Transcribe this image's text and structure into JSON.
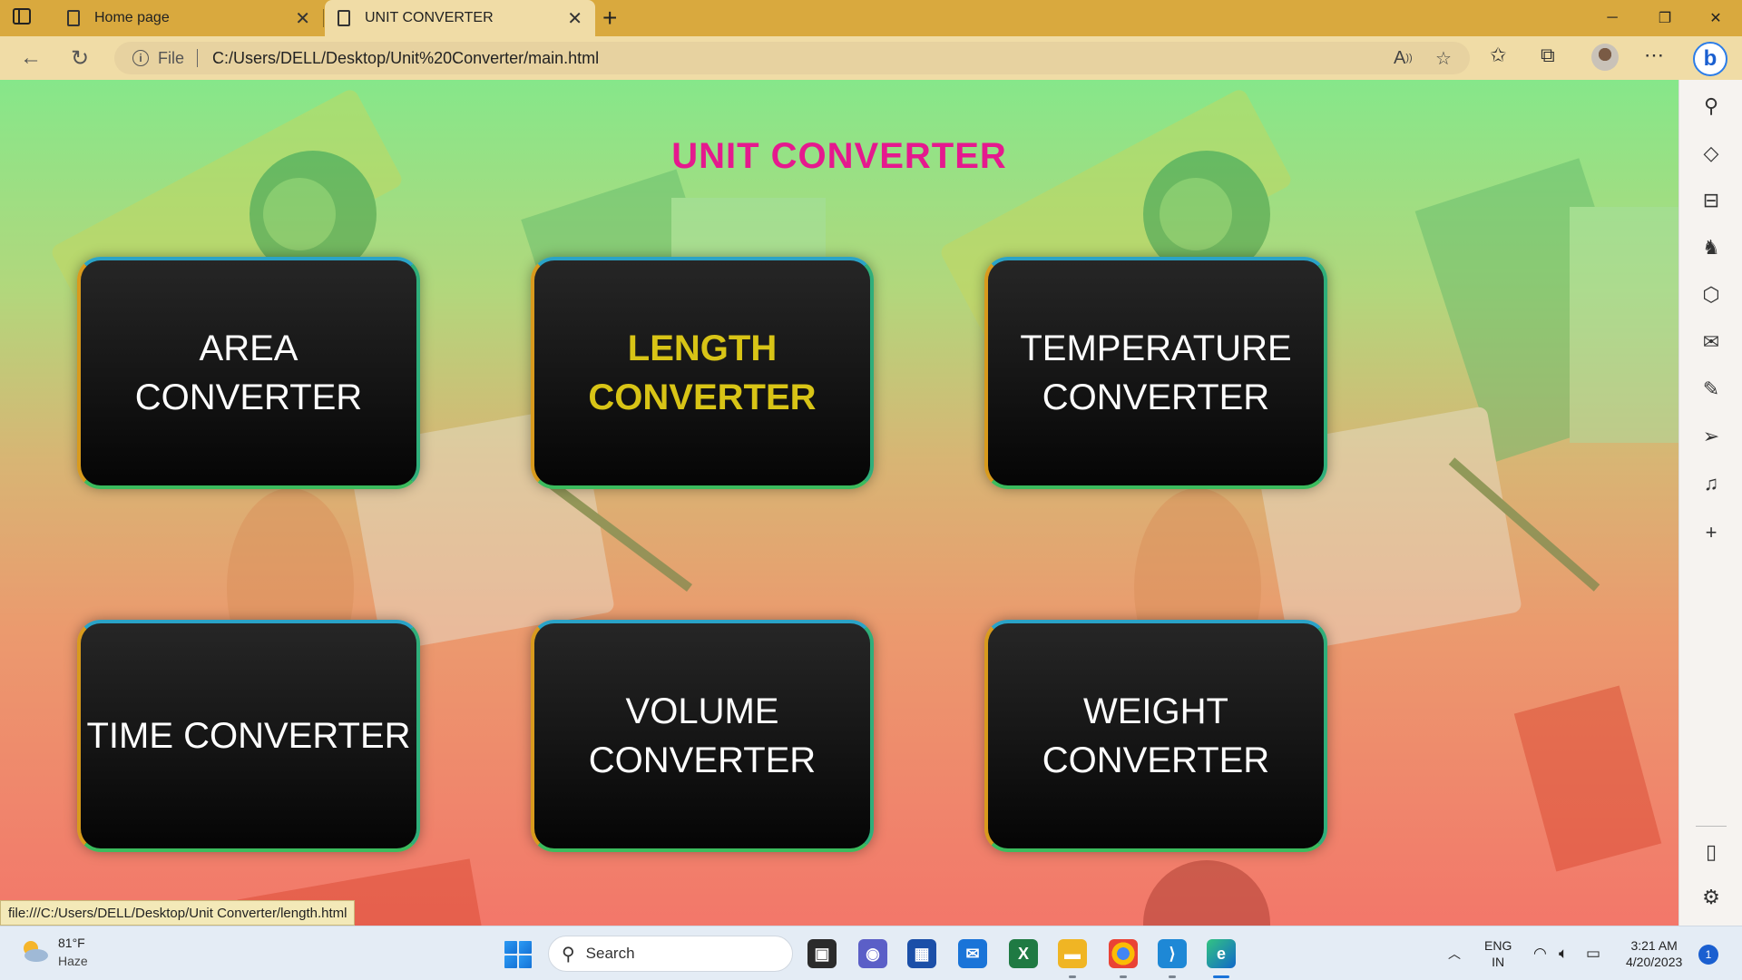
{
  "browser": {
    "tabs": [
      {
        "label": "Home page",
        "active": false
      },
      {
        "label": "UNIT CONVERTER",
        "active": true
      }
    ],
    "address_scheme": "File",
    "address_url": "C:/Users/DELL/Desktop/Unit%20Converter/main.html",
    "status_url": "file:///C:/Users/DELL/Desktop/Unit Converter/length.html"
  },
  "page": {
    "title": "UNIT CONVERTER",
    "title_color": "#e5198e",
    "cards": [
      {
        "label": "AREA CONVERTER",
        "highlighted": false
      },
      {
        "label": "LENGTH CONVERTER",
        "highlighted": true
      },
      {
        "label": "TEMPERATURE CONVERTER",
        "highlighted": false
      },
      {
        "label": "TIME CONVERTER",
        "highlighted": false
      },
      {
        "label": "VOLUME CONVERTER",
        "highlighted": false
      },
      {
        "label": "WEIGHT CONVERTER",
        "highlighted": false
      }
    ],
    "highlight_color": "#d8c416"
  },
  "taskbar": {
    "weather_temp": "81°F",
    "weather_desc": "Haze",
    "search_label": "Search",
    "language": "ENG",
    "region": "IN",
    "time": "3:21 AM",
    "date": "4/20/2023",
    "notification_count": "1"
  }
}
